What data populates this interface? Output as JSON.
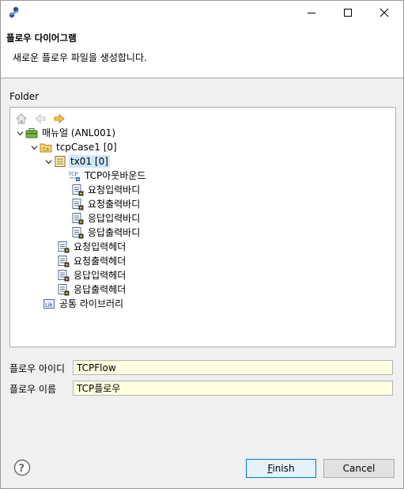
{
  "window": {
    "minimize_glyph": "—",
    "close_glyph": "✕"
  },
  "header": {
    "title": "플로우 다이어그램",
    "description": "새로운 플로우 파일을 생성합니다."
  },
  "folder": {
    "label": "Folder",
    "toolbar": [
      "home-icon",
      "back-arrow-icon",
      "forward-arrow-icon"
    ],
    "tree": [
      {
        "label": "매뉴얼  (ANL001)",
        "icon": "project-icon",
        "expanded": true
      },
      {
        "label": "tcpCase1  [0]",
        "icon": "case-folder-icon",
        "expanded": true
      },
      {
        "label": "tx01  [0]",
        "icon": "transaction-icon",
        "expanded": true,
        "selected": true
      },
      {
        "label": "TCP아웃바운드",
        "icon": "tcp-outbound-icon"
      },
      {
        "label": "요청입력바디",
        "icon": "document-icon"
      },
      {
        "label": "요청출력바디",
        "icon": "document-icon"
      },
      {
        "label": "응답입력바디",
        "icon": "document-icon"
      },
      {
        "label": "응답출력바디",
        "icon": "document-icon"
      },
      {
        "label": "요청입력헤더",
        "icon": "document-icon"
      },
      {
        "label": "요청출력헤더",
        "icon": "document-icon"
      },
      {
        "label": "응답입력헤더",
        "icon": "document-icon"
      },
      {
        "label": "응답출력헤더",
        "icon": "document-icon"
      },
      {
        "label": "공통 라이브러리",
        "icon": "library-icon"
      }
    ]
  },
  "form": {
    "flow_id_label": "플로우 아이디",
    "flow_id_value": "TCPFlow",
    "flow_name_label": "플로우 이름",
    "flow_name_value": "TCP플로우"
  },
  "buttons": {
    "finish_mnemonic": "F",
    "finish_rest": "inish",
    "cancel": "Cancel"
  }
}
